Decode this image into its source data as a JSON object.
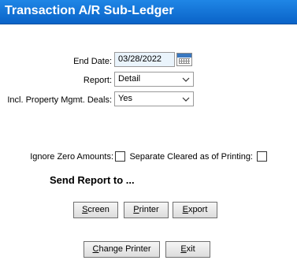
{
  "window": {
    "title": "Transaction A/R Sub-Ledger"
  },
  "form": {
    "end_date": {
      "label": "End Date:",
      "value": "03/28/2022"
    },
    "report": {
      "label": "Report:",
      "value": "Detail"
    },
    "incl_property": {
      "label": "Incl. Property Mgmt. Deals:",
      "value": "Yes"
    },
    "ignore_zero": {
      "label": "Ignore Zero Amounts:",
      "checked": false
    },
    "separate_cleared": {
      "label": "Separate Cleared as of Printing:",
      "checked": false
    }
  },
  "send": {
    "heading": "Send Report to ...",
    "screen": {
      "accel": "S",
      "rest": "creen"
    },
    "printer": {
      "accel": "P",
      "rest": "rinter"
    },
    "export": {
      "accel": "E",
      "rest": "xport"
    }
  },
  "footer": {
    "change_printer": {
      "accel": "C",
      "rest": "hange Printer"
    },
    "exit": {
      "accel": "E",
      "rest": "xit"
    }
  },
  "icons": {
    "calendar": "calendar-icon",
    "dropdown": "chevron-down-icon"
  }
}
